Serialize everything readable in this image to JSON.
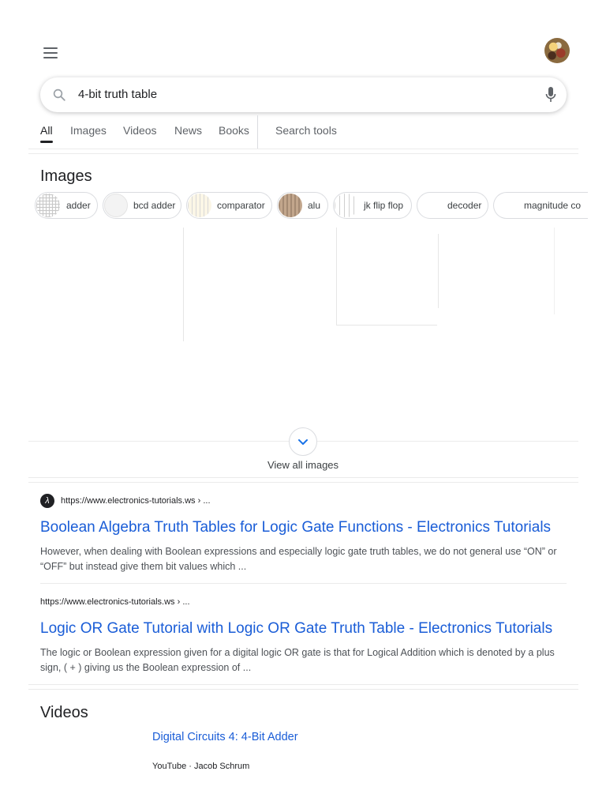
{
  "search": {
    "query": "4-bit truth table"
  },
  "tabs": [
    {
      "label": "All",
      "active": true
    },
    {
      "label": "Images"
    },
    {
      "label": "Videos"
    },
    {
      "label": "News"
    },
    {
      "label": "Books"
    }
  ],
  "search_tools_label": "Search tools",
  "images": {
    "title": "Images",
    "chips": [
      "adder",
      "bcd adder",
      "comparator",
      "alu",
      "jk flip flop",
      "decoder",
      "magnitude co"
    ],
    "view_all_label": "View all images"
  },
  "results": [
    {
      "url": "https://www.electronics-tutorials.ws › ...",
      "title": "Boolean Algebra Truth Tables for Logic Gate Functions - Electronics Tutorials",
      "snippet": "However, when dealing with Boolean expressions and especially logic gate truth tables, we do not general use “ON” or “OFF” but instead give them bit values which ..."
    },
    {
      "url": "https://www.electronics-tutorials.ws › ...",
      "title": "Logic OR Gate Tutorial with Logic OR Gate Truth Table - Electronics Tutorials",
      "snippet": "The logic or Boolean expression given for a digital logic OR gate is that for Logical Addition which is denoted by a plus sign, ( + ) giving us the Boolean expression of ..."
    }
  ],
  "videos": {
    "title": "Videos",
    "items": [
      {
        "title": "Digital Circuits 4: 4-Bit Adder",
        "meta": "YouTube · Jacob Schrum"
      }
    ]
  },
  "icons": {
    "menu": "hamburger-menu-icon",
    "search": "search-icon",
    "mic": "microphone-icon",
    "chevron": "chevron-down-icon",
    "favicon": "electronics-tutorials-favicon"
  },
  "colors": {
    "link": "#1a0dab",
    "link_blue": "#1a5dd7",
    "text": "#202124",
    "snippet": "#4d5156"
  }
}
